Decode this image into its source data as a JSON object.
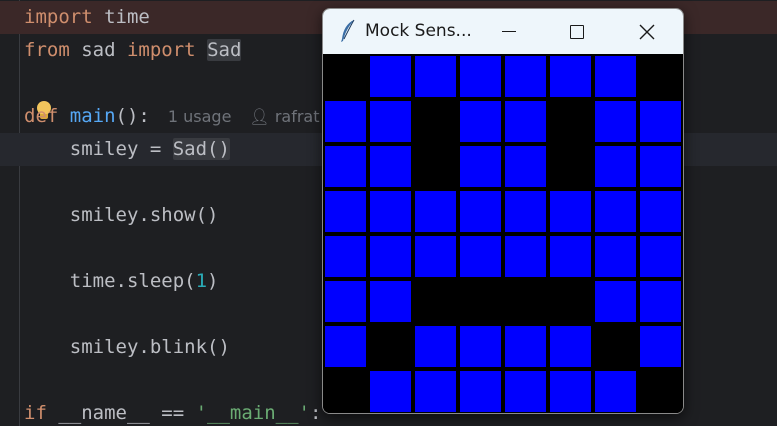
{
  "editor": {
    "lines": {
      "l1": {
        "kw": "import",
        "rest": " time"
      },
      "l2": {
        "kw1": "from",
        "mid": " sad ",
        "kw2": "import",
        "name": "Sad"
      },
      "l4": {
        "kw": "def",
        "fn": "main",
        "tail": "():",
        "hint": "1 usage",
        "user": "rafrat"
      },
      "l5": {
        "pre": "    smiley = ",
        "call": "Sad()"
      },
      "l7": {
        "text": "    smiley.show()"
      },
      "l9": {
        "pre": "    time.sleep(",
        "num": "1",
        "post": ")"
      },
      "l11": {
        "text": "    smiley.blink()"
      },
      "l13": {
        "kw": "if",
        "mid": " __name__ == ",
        "str": "'__main__'",
        "post": ":"
      }
    }
  },
  "window": {
    "title": "Mock Sens...",
    "app_icon": "feather-icon",
    "controls": [
      "minimize-icon",
      "maximize-icon",
      "close-icon"
    ]
  },
  "led_matrix": {
    "rows": 8,
    "cols": 8,
    "on_color": "#0000ff",
    "off_color": "#000000",
    "pixels": [
      [
        0,
        1,
        1,
        1,
        1,
        1,
        1,
        0
      ],
      [
        1,
        1,
        0,
        1,
        1,
        0,
        1,
        1
      ],
      [
        1,
        1,
        0,
        1,
        1,
        0,
        1,
        1
      ],
      [
        1,
        1,
        1,
        1,
        1,
        1,
        1,
        1
      ],
      [
        1,
        1,
        1,
        1,
        1,
        1,
        1,
        1
      ],
      [
        1,
        1,
        0,
        0,
        0,
        0,
        1,
        1
      ],
      [
        1,
        0,
        1,
        1,
        1,
        1,
        0,
        1
      ],
      [
        0,
        1,
        1,
        1,
        1,
        1,
        1,
        0
      ]
    ]
  }
}
